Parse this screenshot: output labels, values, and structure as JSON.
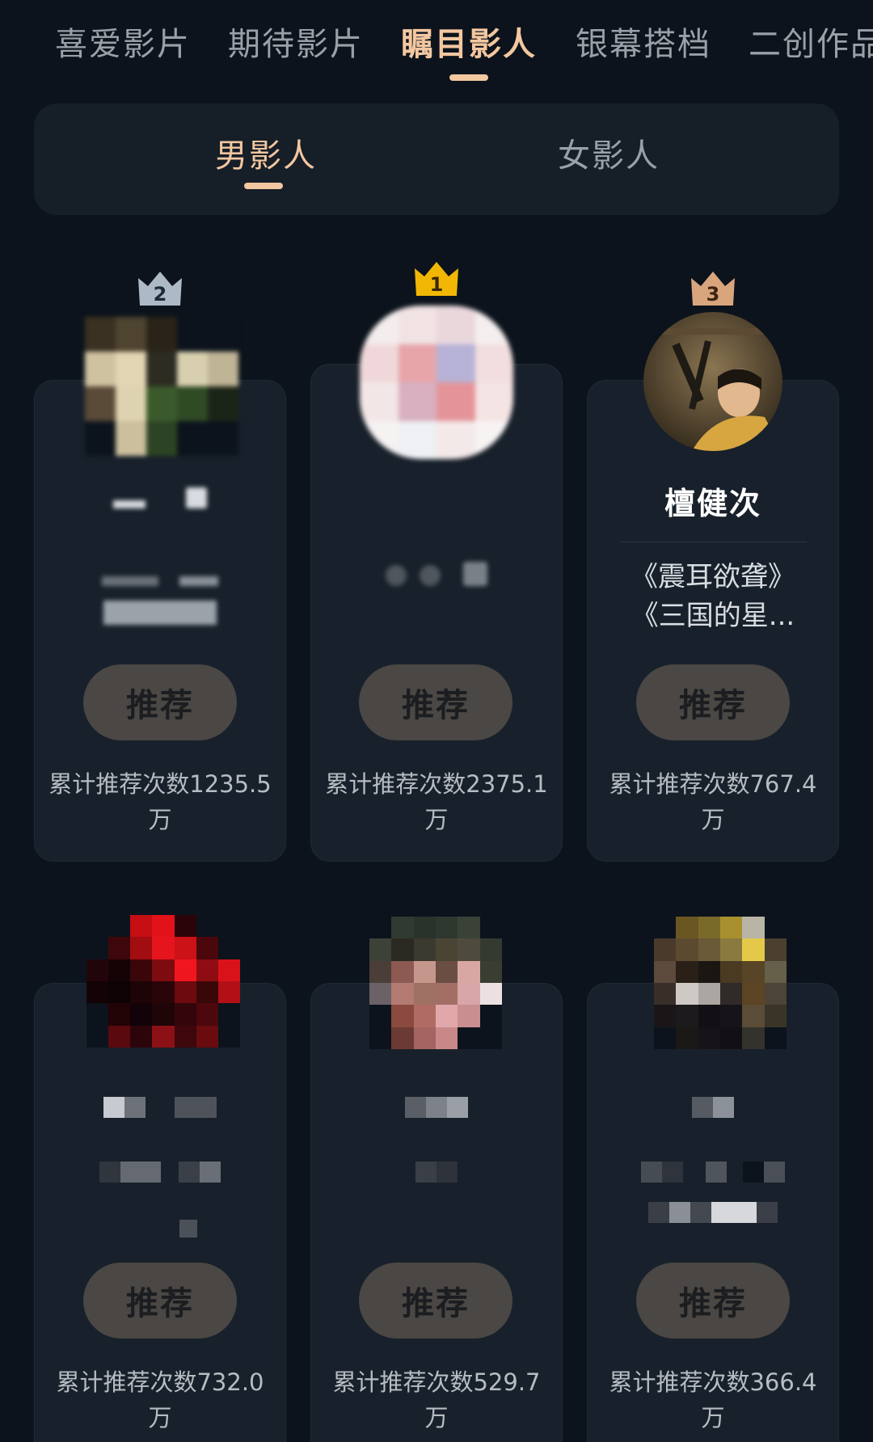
{
  "top_tabs": [
    {
      "label": "喜爱影片"
    },
    {
      "label": "期待影片"
    },
    {
      "label": "瞩目影人"
    },
    {
      "label": "银幕搭档"
    },
    {
      "label": "二创作品"
    }
  ],
  "active_top_tab": "瞩目影人",
  "gender_tabs": [
    {
      "label": "男影人"
    },
    {
      "label": "女影人"
    }
  ],
  "active_gender_tab": "男影人",
  "recommend_label": "推荐",
  "cards": [
    {
      "rank": "2",
      "name": "",
      "works_1": "",
      "works_2": "",
      "count_line1": "累计推荐次数1235.5",
      "count_line2": "万"
    },
    {
      "rank": "1",
      "name": "",
      "works_1": "",
      "works_2": "",
      "count_line1": "累计推荐次数2375.1",
      "count_line2": "万"
    },
    {
      "rank": "3",
      "name": "檀健次",
      "works_1": "《震耳欲聋》",
      "works_2": "《三国的星...",
      "count_line1": "累计推荐次数767.4",
      "count_line2": "万"
    },
    {
      "rank": "",
      "name": "",
      "works_1": "",
      "works_2": "",
      "count_line1": "累计推荐次数732.0",
      "count_line2": "万"
    },
    {
      "rank": "",
      "name": "",
      "works_1": "",
      "works_2": "",
      "count_line1": "累计推荐次数529.7",
      "count_line2": "万"
    },
    {
      "rank": "",
      "name": "",
      "works_1": "",
      "works_2": "",
      "count_line1": "累计推荐次数366.4",
      "count_line2": "万"
    }
  ],
  "colors": {
    "background": "#0c131c",
    "accent": "#f3c7a0",
    "card": "#18212b",
    "button": "#4a4744",
    "crown_gold": "#f2b705",
    "crown_silver": "#aeb9c6",
    "crown_bronze": "#d9a57d"
  },
  "icons": {
    "rank1": "gold-crown-icon",
    "rank2": "silver-crown-icon",
    "rank3": "bronze-crown-icon"
  }
}
